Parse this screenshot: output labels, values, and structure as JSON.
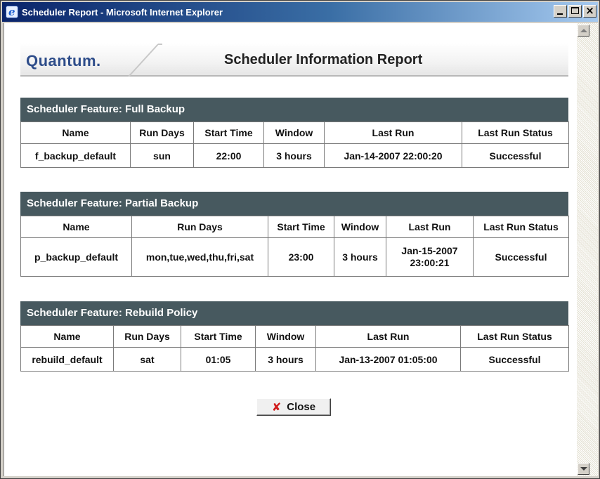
{
  "window": {
    "title": "Scheduler Report - Microsoft Internet Explorer",
    "icon": "ie-icon",
    "controls": {
      "minimize": "_",
      "maximize": "□",
      "close": "×"
    }
  },
  "banner": {
    "logo": "Quantum.",
    "title": "Scheduler Information Report"
  },
  "sections": [
    {
      "title": "Scheduler Feature: Full Backup",
      "headers": [
        "Name",
        "Run Days",
        "Start Time",
        "Window",
        "Last Run",
        "Last Run Status"
      ],
      "rows": [
        [
          "f_backup_default",
          "sun",
          "22:00",
          "3 hours",
          "Jan-14-2007 22:00:20",
          "Successful"
        ]
      ]
    },
    {
      "title": "Scheduler Feature: Partial Backup",
      "headers": [
        "Name",
        "Run Days",
        "Start Time",
        "Window",
        "Last Run",
        "Last Run Status"
      ],
      "rows": [
        [
          "p_backup_default",
          "mon,tue,wed,thu,fri,sat",
          "23:00",
          "3 hours",
          "Jan-15-2007 23:00:21",
          "Successful"
        ]
      ]
    },
    {
      "title": "Scheduler Feature: Rebuild Policy",
      "headers": [
        "Name",
        "Run Days",
        "Start Time",
        "Window",
        "Last Run",
        "Last Run Status"
      ],
      "rows": [
        [
          "rebuild_default",
          "sat",
          "01:05",
          "3 hours",
          "Jan-13-2007 01:05:00",
          "Successful"
        ]
      ]
    }
  ],
  "close_button": {
    "label": "Close",
    "icon": "x-icon",
    "icon_color": "#d11b1b"
  },
  "colors": {
    "section_header_bg": "#47595f",
    "logo": "#2e4d8a"
  }
}
